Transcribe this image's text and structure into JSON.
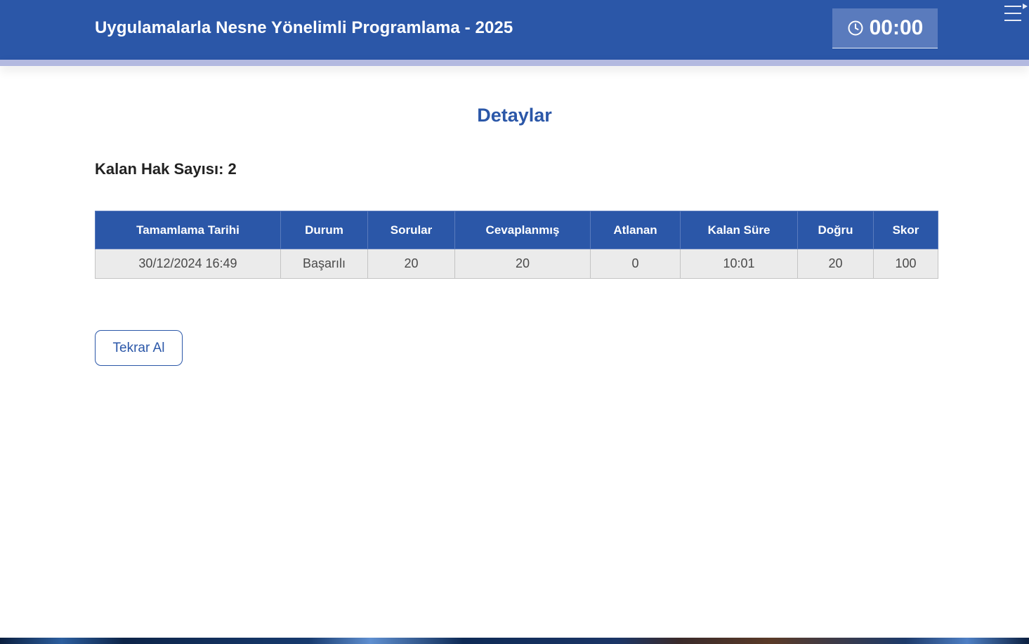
{
  "header": {
    "title": "Uygulamalarla Nesne Yönelimli Programlama - 2025",
    "timer": {
      "icon": "clock-icon",
      "value": "00:00"
    },
    "menu_icon": "menu-collapse-icon"
  },
  "main": {
    "section_title": "Detaylar",
    "remaining_attempts": "Kalan Hak Sayısı: 2",
    "table": {
      "headers": [
        "Tamamlama Tarihi",
        "Durum",
        "Sorular",
        "Cevaplanmış",
        "Atlanan",
        "Kalan Süre",
        "Doğru",
        "Skor"
      ],
      "rows": [
        [
          "30/12/2024 16:49",
          "Başarılı",
          "20",
          "20",
          "0",
          "10:01",
          "20",
          "100"
        ]
      ]
    },
    "retry_label": "Tekrar Al"
  },
  "colors": {
    "brand": "#2b57a8",
    "timer_bg": "#5a7bbd",
    "strip": "#b3b9e0",
    "cell_bg": "#ebebeb"
  }
}
